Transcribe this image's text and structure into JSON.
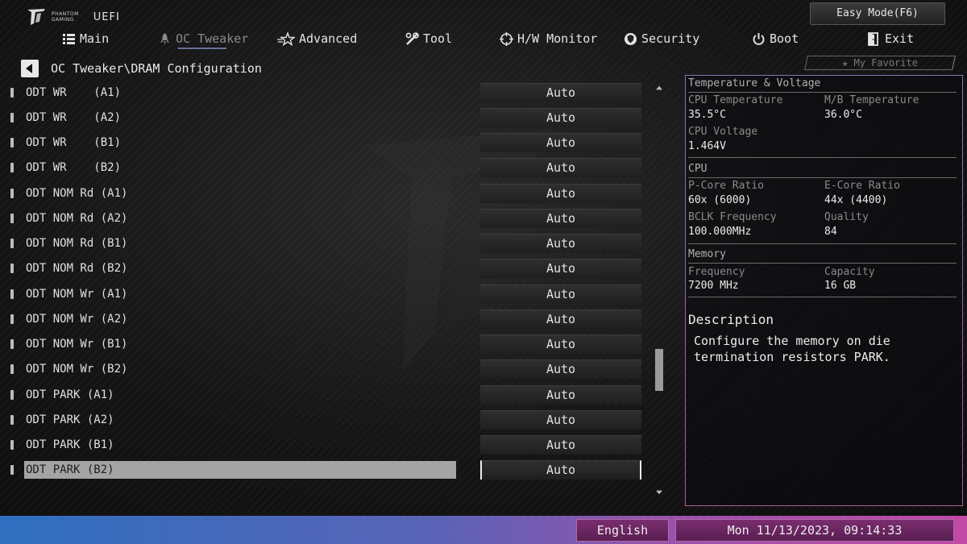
{
  "header": {
    "brand_line1": "PHANTOM",
    "brand_line2": "GAMING",
    "uefi_label": "UEFI",
    "easy_mode_label": "Easy Mode(F6)"
  },
  "nav": {
    "tabs": [
      {
        "label": "Main",
        "icon": "list-icon",
        "active": false
      },
      {
        "label": "OC Tweaker",
        "icon": "rocket-icon",
        "active": true
      },
      {
        "label": "Advanced",
        "icon": "star-icon",
        "active": false
      },
      {
        "label": "Tool",
        "icon": "tools-icon",
        "active": false
      },
      {
        "label": "H/W Monitor",
        "icon": "crosshair-icon",
        "active": false
      },
      {
        "label": "Security",
        "icon": "shield-icon",
        "active": false
      },
      {
        "label": "Boot",
        "icon": "power-icon",
        "active": false
      },
      {
        "label": "Exit",
        "icon": "exit-icon",
        "active": false
      }
    ]
  },
  "breadcrumb": "OC Tweaker\\DRAM Configuration",
  "favorite_label": "My Favorite",
  "settings": [
    {
      "label": "ODT WR    (A1)",
      "value": "Auto"
    },
    {
      "label": "ODT WR    (A2)",
      "value": "Auto"
    },
    {
      "label": "ODT WR    (B1)",
      "value": "Auto"
    },
    {
      "label": "ODT WR    (B2)",
      "value": "Auto"
    },
    {
      "label": "ODT NOM Rd (A1)",
      "value": "Auto"
    },
    {
      "label": "ODT NOM Rd (A2)",
      "value": "Auto"
    },
    {
      "label": "ODT NOM Rd (B1)",
      "value": "Auto"
    },
    {
      "label": "ODT NOM Rd (B2)",
      "value": "Auto"
    },
    {
      "label": "ODT NOM Wr (A1)",
      "value": "Auto"
    },
    {
      "label": "ODT NOM Wr (A2)",
      "value": "Auto"
    },
    {
      "label": "ODT NOM Wr (B1)",
      "value": "Auto"
    },
    {
      "label": "ODT NOM Wr (B2)",
      "value": "Auto"
    },
    {
      "label": "ODT PARK (A1)",
      "value": "Auto"
    },
    {
      "label": "ODT PARK (A2)",
      "value": "Auto"
    },
    {
      "label": "ODT PARK (B1)",
      "value": "Auto"
    },
    {
      "label": "ODT PARK (B2)",
      "value": "Auto",
      "selected": true
    }
  ],
  "panel": {
    "temp_section": "Temperature & Voltage",
    "cpu_temp_label": "CPU Temperature",
    "cpu_temp_value": "35.5°C",
    "mb_temp_label": "M/B Temperature",
    "mb_temp_value": "36.0°C",
    "cpu_voltage_label": "CPU Voltage",
    "cpu_voltage_value": "1.464V",
    "cpu_section": "CPU",
    "pcore_label": "P-Core Ratio",
    "pcore_value": "60x (6000)",
    "ecore_label": "E-Core Ratio",
    "ecore_value": "44x (4400)",
    "bclk_label": "BCLK Frequency",
    "bclk_value": "100.000MHz",
    "quality_label": "Quality",
    "quality_value": "84",
    "memory_section": "Memory",
    "freq_label": "Frequency",
    "freq_value": "7200 MHz",
    "capacity_label": "Capacity",
    "capacity_value": "16 GB",
    "description_title": "Description",
    "description_text": "Configure the memory on die termination resistors PARK."
  },
  "footer": {
    "language": "English",
    "datetime": "Mon 11/13/2023, 09:14:33"
  }
}
